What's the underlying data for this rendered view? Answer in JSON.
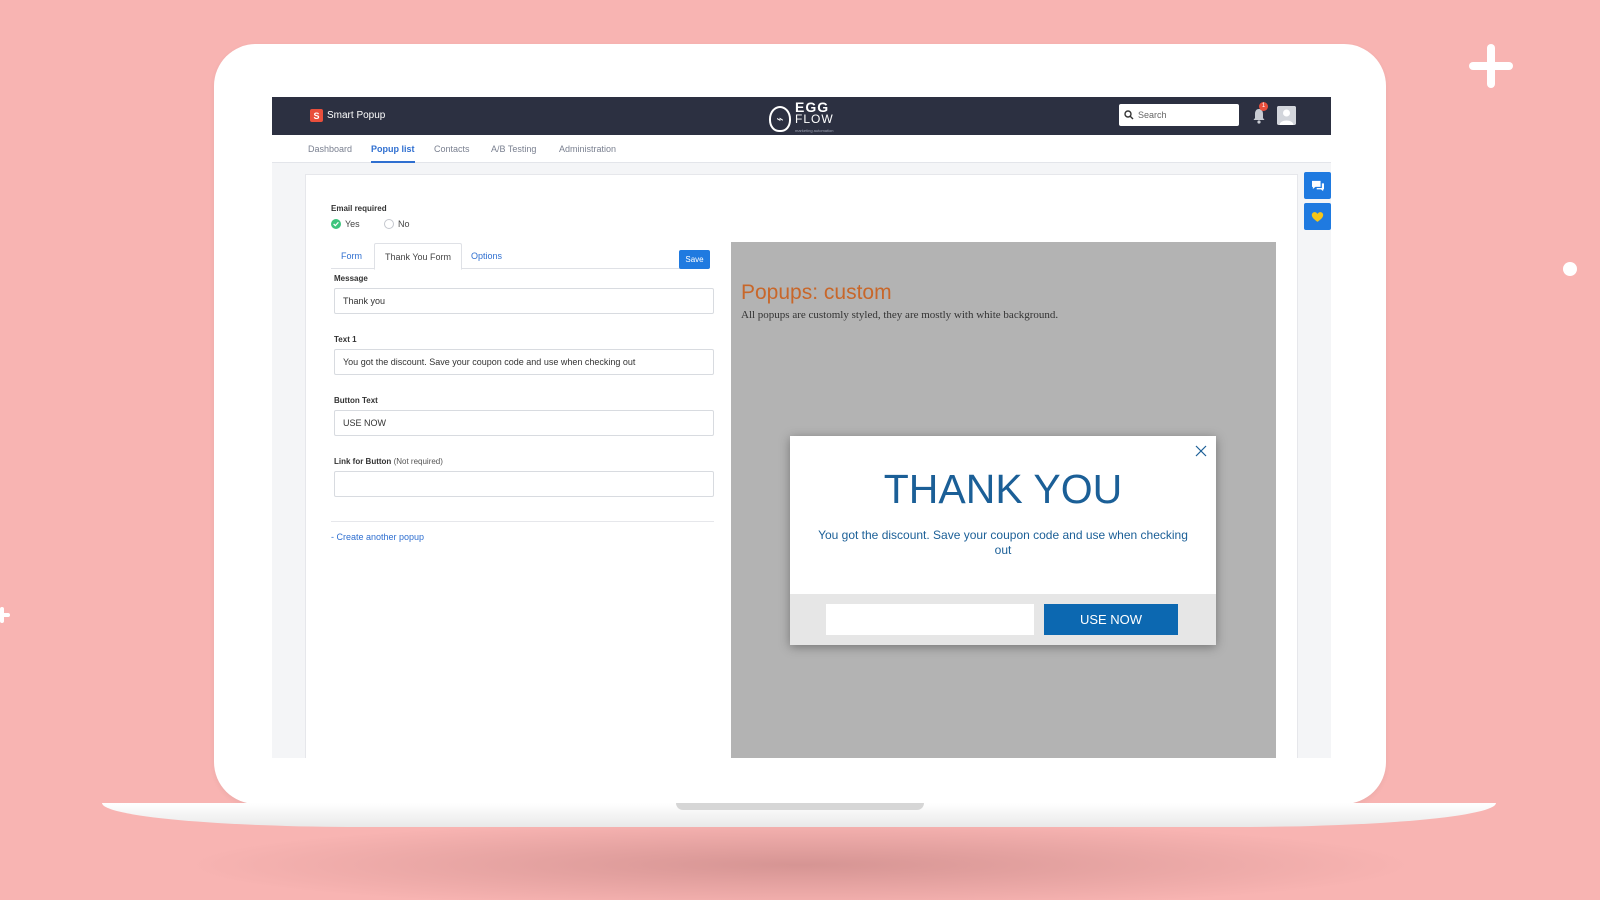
{
  "app": {
    "name": "Smart Popup",
    "logo_top": "EGG",
    "logo_bottom": "FLOW",
    "logo_tagline": "marketing automation"
  },
  "header": {
    "search_placeholder": "Search",
    "notification_count": "1"
  },
  "nav": {
    "items": [
      {
        "label": "Dashboard"
      },
      {
        "label": "Popup list"
      },
      {
        "label": "Contacts"
      },
      {
        "label": "A/B Testing"
      },
      {
        "label": "Administration"
      }
    ],
    "active": "Popup list"
  },
  "form": {
    "email_required_label": "Email required",
    "yes_label": "Yes",
    "no_label": "No",
    "selected": "Yes",
    "tabs": [
      {
        "label": "Form"
      },
      {
        "label": "Thank You Form"
      },
      {
        "label": "Options"
      }
    ],
    "active_tab": "Thank You Form",
    "save_label": "Save",
    "fields": {
      "message": {
        "label": "Message",
        "value": "Thank you"
      },
      "text1": {
        "label": "Text 1",
        "value": "You got the discount. Save your coupon code and use when checking out"
      },
      "button_text": {
        "label": "Button Text",
        "value": "USE NOW"
      },
      "link": {
        "label": "Link for Button",
        "hint": "(Not required)",
        "value": ""
      }
    },
    "create_link": "- Create another popup"
  },
  "preview": {
    "title": "Popups: custom",
    "description": "All popups are customly styled, they are mostly with white background.",
    "popup": {
      "title": "THANK YOU",
      "text": "You got the discount. Save your coupon code and use when checking out",
      "input_value": "",
      "button_label": "USE NOW"
    }
  },
  "colors": {
    "background": "#f8b4b2",
    "topbar": "#2c3041",
    "accent": "#1f7ae0",
    "preview_title": "#c8672a",
    "popup_text": "#1b5f97",
    "popup_button": "#0c68b1",
    "favorite_heart": "#f5c518"
  },
  "icons": {
    "brand": "smart-popup-icon",
    "search": "search-icon",
    "notifications": "bell-icon",
    "user": "avatar-icon",
    "chat": "chat-icon",
    "favorite": "heart-icon",
    "close": "close-icon",
    "selected_radio": "check-icon"
  }
}
